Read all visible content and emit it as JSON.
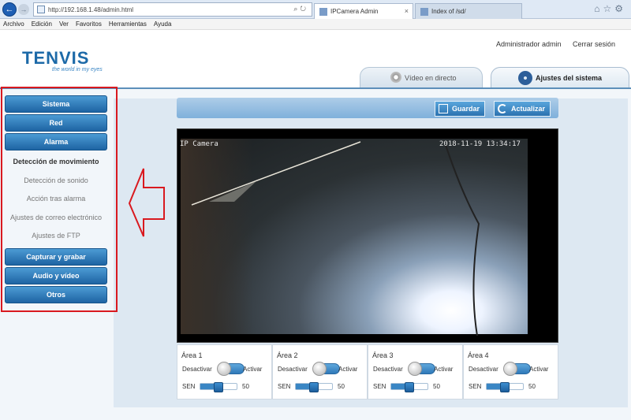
{
  "browser": {
    "url": "http://192.168.1.48/admin.html",
    "tabs": [
      {
        "label": "IPCamera Admin"
      },
      {
        "label": "Index of /sd/"
      }
    ]
  },
  "menubar": [
    "Archivo",
    "Edición",
    "Ver",
    "Favoritos",
    "Herramientas",
    "Ayuda"
  ],
  "header": {
    "logo": "TENVIS",
    "tagline": "the world in my eyes",
    "user": "Administrador admin",
    "logout": "Cerrar sesión",
    "tabs": [
      "Vídeo en directo",
      "Ajustes del sistema"
    ]
  },
  "sidebar": {
    "top_items": [
      "Sistema",
      "Red",
      "Alarma"
    ],
    "sub_items": [
      {
        "label": "Detección de movimiento",
        "active": true
      },
      {
        "label": "Detección de sonido",
        "active": false
      },
      {
        "label": "Acción tras alarma",
        "active": false
      },
      {
        "label": "Ajustes de correo electrónico",
        "active": false
      },
      {
        "label": "Ajustes de FTP",
        "active": false
      }
    ],
    "bottom_items": [
      "Capturar y grabar",
      "Audio y vídeo",
      "Otros"
    ]
  },
  "toolbar": {
    "save_label": "Guardar",
    "refresh_label": "Actualizar"
  },
  "video": {
    "label": "IP Camera",
    "timestamp": "2018-11-19 13:34:17"
  },
  "areas": [
    {
      "title": "Área 1",
      "off_label": "Desactivar",
      "on_label": "Activar",
      "sen_label": "SEN",
      "sensitivity": 50
    },
    {
      "title": "Área 2",
      "off_label": "Desactivar",
      "on_label": "Activar",
      "sen_label": "SEN",
      "sensitivity": 50
    },
    {
      "title": "Área 3",
      "off_label": "Desactivar",
      "on_label": "Activar",
      "sen_label": "SEN",
      "sensitivity": 50
    },
    {
      "title": "Área 4",
      "off_label": "Desactivar",
      "on_label": "Activar",
      "sen_label": "SEN",
      "sensitivity": 50
    }
  ],
  "colors": {
    "accent": "#1e64a3",
    "highlight_frame": "#d9191f"
  }
}
